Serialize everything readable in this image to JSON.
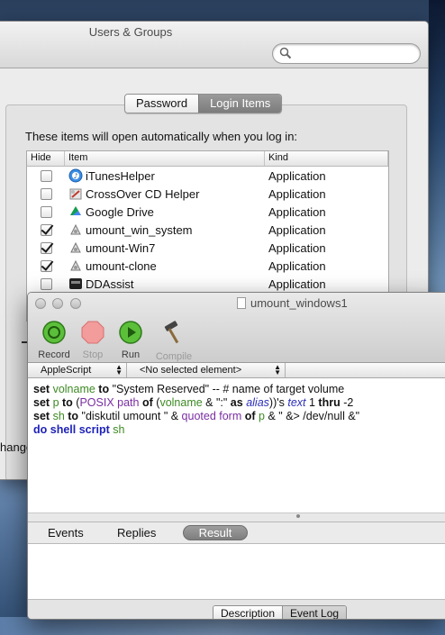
{
  "users_groups": {
    "title": "Users & Groups",
    "search_placeholder": "",
    "tabs": [
      {
        "label": "Password",
        "selected": false
      },
      {
        "label": "Login Items",
        "selected": true
      }
    ],
    "description": "These items will open automatically when you log in:",
    "columns": {
      "hide": "Hide",
      "item": "Item",
      "kind": "Kind"
    },
    "items": [
      {
        "hide": false,
        "name": "iTunesHelper",
        "kind": "Application",
        "icon": "itunes-icon"
      },
      {
        "hide": false,
        "name": "CrossOver CD Helper",
        "kind": "Application",
        "icon": "crossover-icon"
      },
      {
        "hide": false,
        "name": "Google Drive",
        "kind": "Application",
        "icon": "google-drive-icon"
      },
      {
        "hide": true,
        "name": "umount_win_system",
        "kind": "Application",
        "icon": "applescript-icon"
      },
      {
        "hide": true,
        "name": "umount-Win7",
        "kind": "Application",
        "icon": "applescript-icon"
      },
      {
        "hide": true,
        "name": "umount-clone",
        "kind": "Application",
        "icon": "applescript-icon"
      },
      {
        "hide": false,
        "name": "DDAssist",
        "kind": "Application",
        "icon": "ddassist-icon"
      }
    ],
    "partial_text": "hange"
  },
  "script_editor": {
    "title": "umount_windows1",
    "toolbar": {
      "record": "Record",
      "stop": "Stop",
      "run": "Run",
      "compile": "Compile"
    },
    "language": "AppleScript",
    "element": "<No selected element>",
    "code": {
      "line1": {
        "k1": "set",
        "v1": "volname",
        "k2": "to",
        "s1": "\"System Reserved\" -- # name of target volume"
      },
      "line2": {
        "k1": "set",
        "v1": "p",
        "k2": "to",
        "p1": "(",
        "c1": "POSIX path",
        "k3": "of",
        "p2": "(",
        "v2": "volname",
        "p3": " & \":\" ",
        "k4": "as",
        "c2": "alias",
        "p4": "))'s ",
        "i1": "text",
        "p5": " 1 ",
        "k5": "thru",
        "p6": " -2"
      },
      "line3": {
        "k1": "set",
        "v1": "sh",
        "k2": "to",
        "s1": " \"diskutil umount \" & ",
        "c1": "quoted form",
        "k3": "of",
        "v2": "p",
        "s2": " & \" &> /dev/null &\""
      },
      "line4": {
        "c1": "do shell script",
        "v1": "sh"
      }
    },
    "tabs": {
      "events": "Events",
      "replies": "Replies",
      "result": "Result"
    },
    "bottom": {
      "description": "Description",
      "event_log": "Event Log"
    }
  }
}
